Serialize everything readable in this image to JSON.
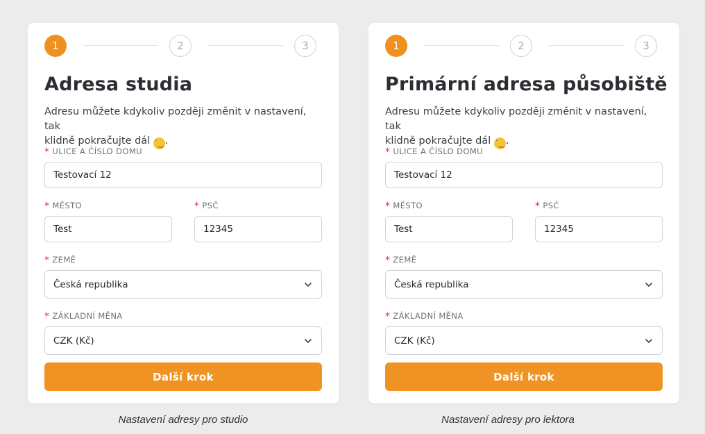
{
  "forms": [
    {
      "steps": [
        "1",
        "2",
        "3"
      ],
      "active_step": 1,
      "title": "Adresa studia",
      "intro_line1": "Adresu můžete kdykoliv později změnit v nastavení, tak",
      "intro_line2": "klidně pokračujte dál",
      "intro_end": ".",
      "street_label": "ULICE A ČÍSLO DOMU",
      "street_value": "Testovací 12",
      "city_label": "MĚSTO",
      "city_value": "Test",
      "zip_label": "PSČ",
      "zip_value": "12345",
      "country_label": "ZEMĚ",
      "country_value": "Česká republika",
      "currency_label": "ZÁKLADNÍ MĚNA",
      "currency_value": "CZK (Kč)",
      "next_label": "Další krok",
      "caption": "Nastavení adresy pro studio"
    },
    {
      "steps": [
        "1",
        "2",
        "3"
      ],
      "active_step": 1,
      "title": "Primární adresa působiště",
      "intro_line1": "Adresu můžete kdykoliv později změnit v nastavení, tak",
      "intro_line2": "klidně pokračujte dál",
      "intro_end": ".",
      "street_label": "ULICE A ČÍSLO DOMU",
      "street_value": "Testovací 12",
      "city_label": "MĚSTO",
      "city_value": "Test",
      "zip_label": "PSČ",
      "zip_value": "12345",
      "country_label": "ZEMĚ",
      "country_value": "Česká republika",
      "currency_label": "ZÁKLADNÍ MĚNA",
      "currency_value": "CZK (Kč)",
      "next_label": "Další krok",
      "caption": "Nastavení adresy pro lektora"
    }
  ],
  "icons": {
    "emoji": "winking-face-icon",
    "chevron": "chevron-down-icon"
  },
  "colors": {
    "accent": "#ef9325",
    "required": "#e0342f",
    "page_bg": "#ececed"
  }
}
